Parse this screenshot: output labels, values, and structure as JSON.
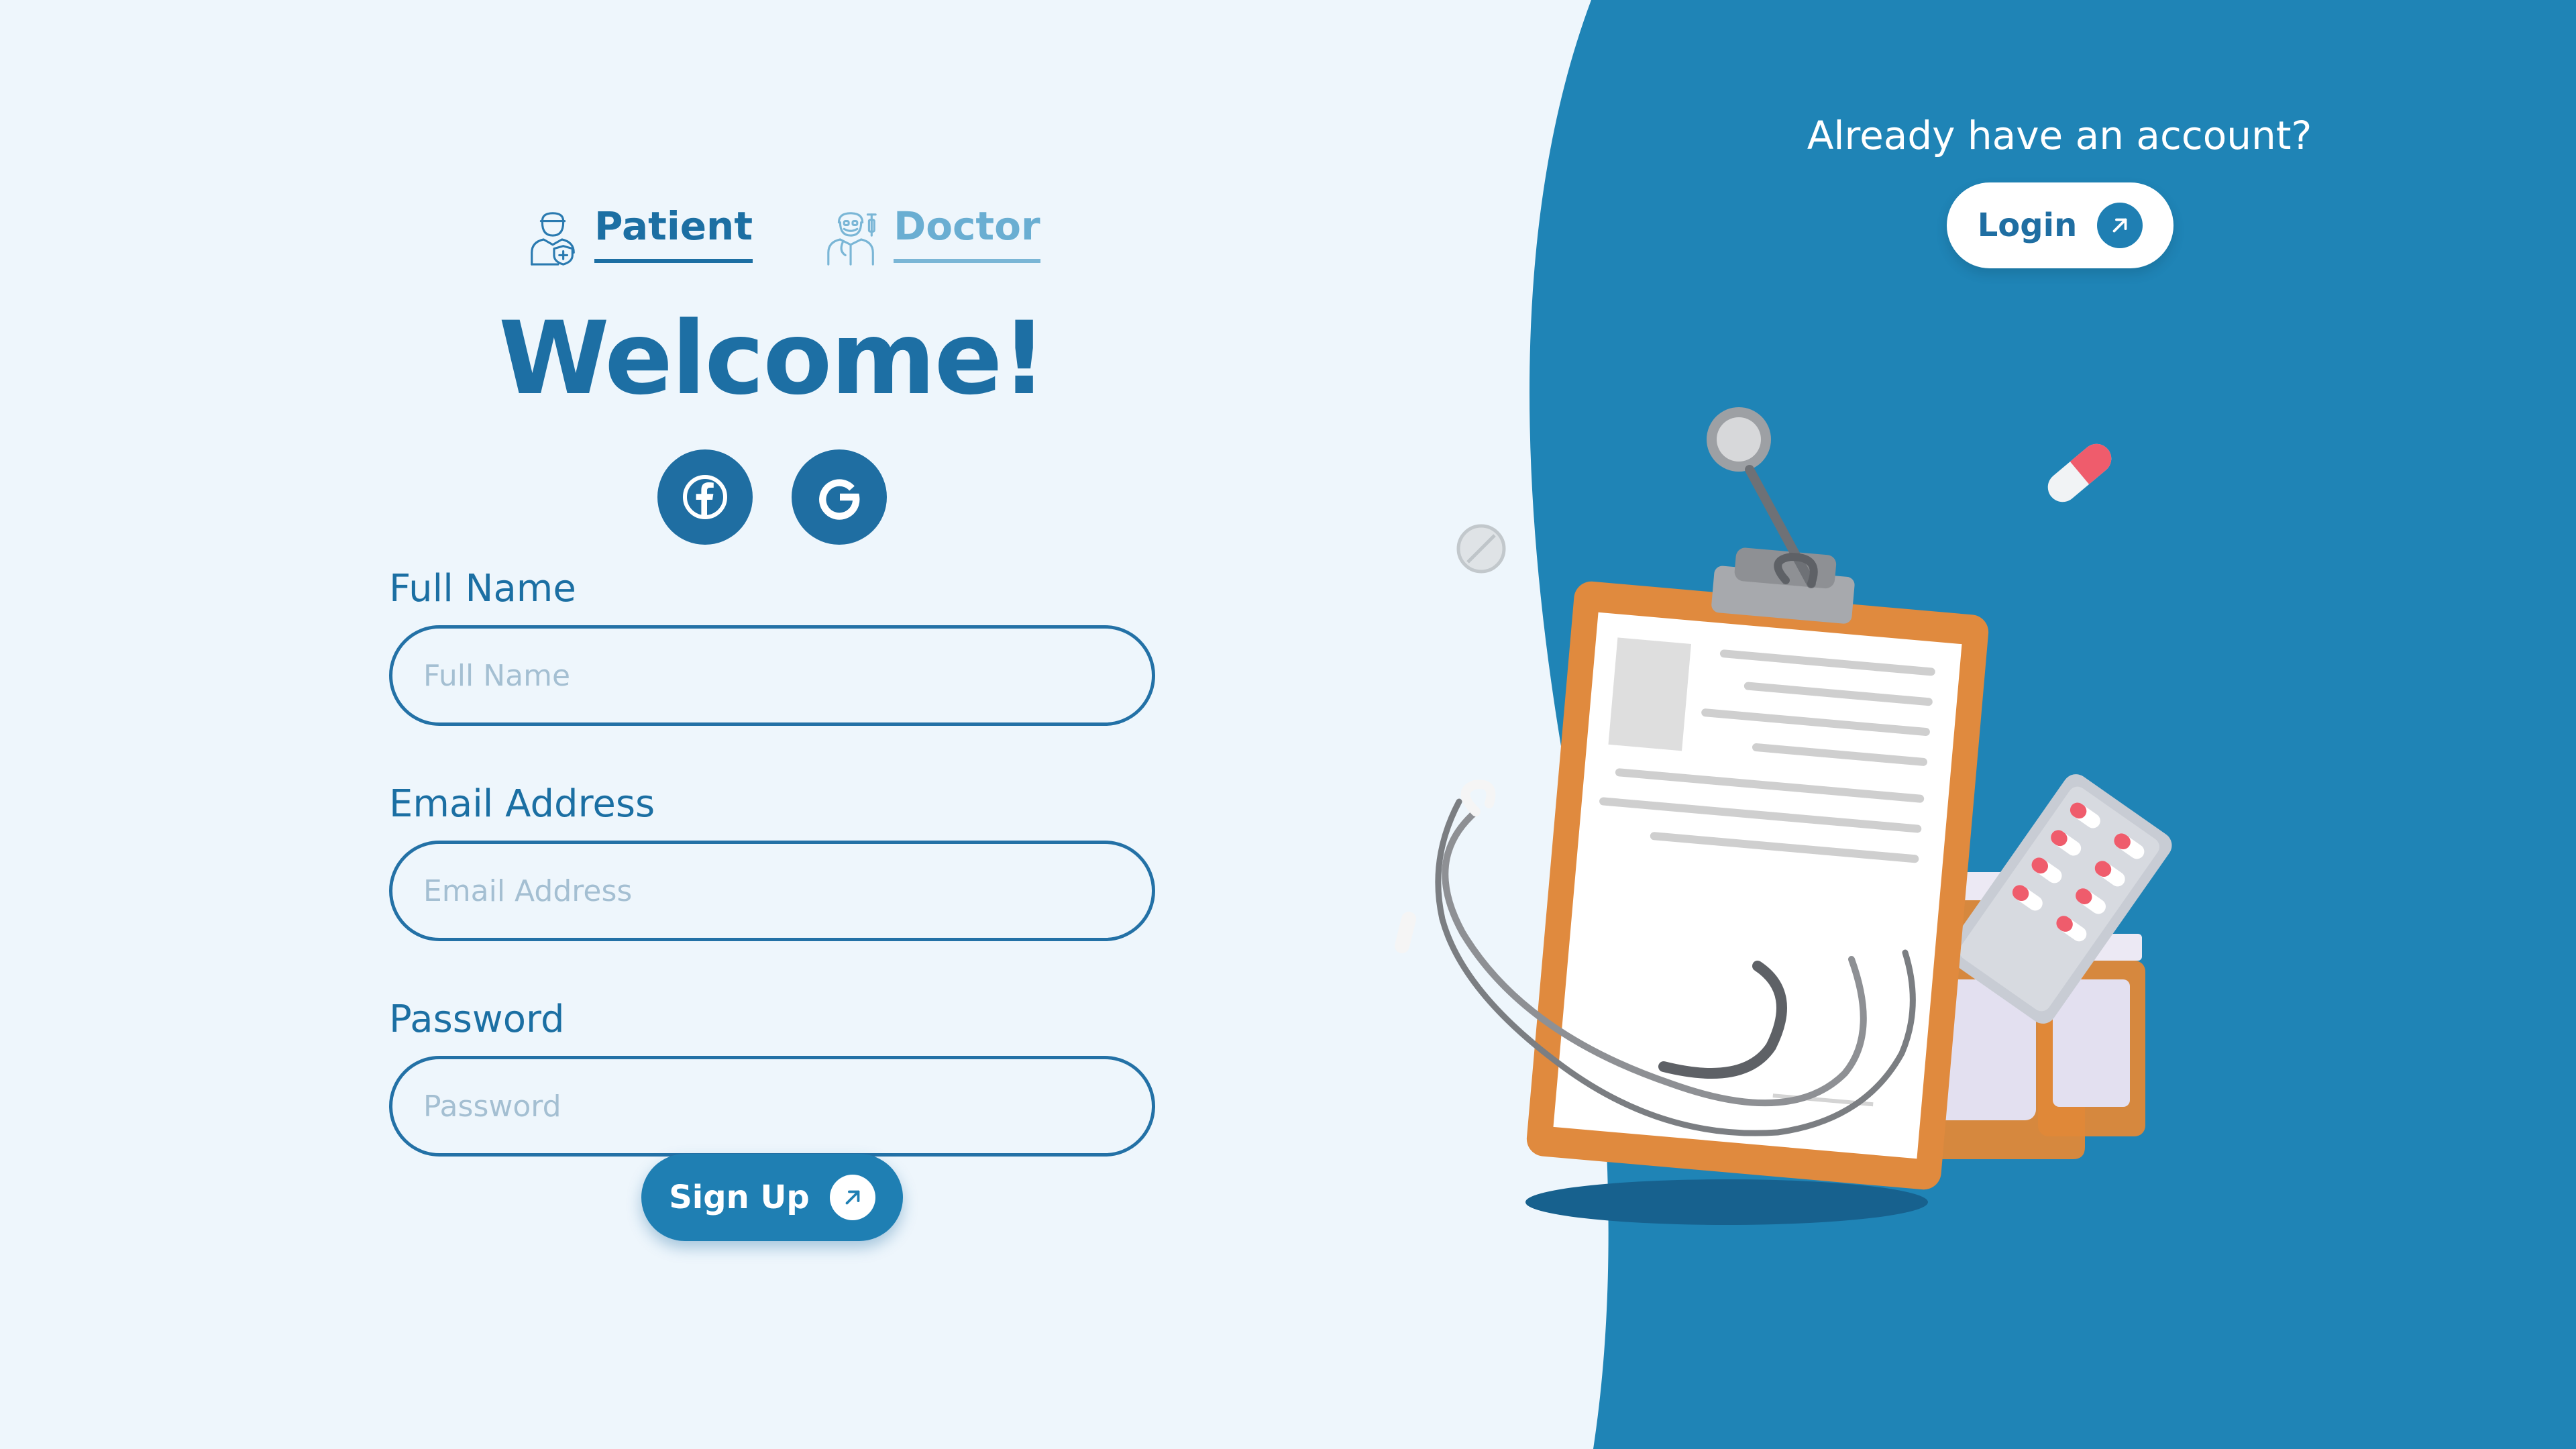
{
  "colors": {
    "page_background": "#eef6fc",
    "panel_blue": "#1f84b6",
    "primary": "#1d6fa4",
    "tab_inactive": "#6aaed2",
    "input_border": "#2371a6"
  },
  "tabs": [
    {
      "label": "Patient",
      "icon": "patient-icon",
      "active": true
    },
    {
      "label": "Doctor",
      "icon": "doctor-icon",
      "active": false
    }
  ],
  "title": "Welcome!",
  "social": [
    {
      "icon": "facebook-icon"
    },
    {
      "icon": "google-icon"
    }
  ],
  "form": {
    "full_name": {
      "label": "Full Name",
      "placeholder": "Full Name"
    },
    "email": {
      "label": "Email Address",
      "placeholder": "Email Address"
    },
    "password": {
      "label": "Password",
      "placeholder": "Password"
    }
  },
  "signup": {
    "label": "Sign Up",
    "icon": "arrow-up-right-icon"
  },
  "account": {
    "prompt": "Already have an account?",
    "login_label": "Login",
    "login_icon": "arrow-up-right-icon"
  },
  "illustration": "medical-clipboard-stethoscope-pills-illustration"
}
